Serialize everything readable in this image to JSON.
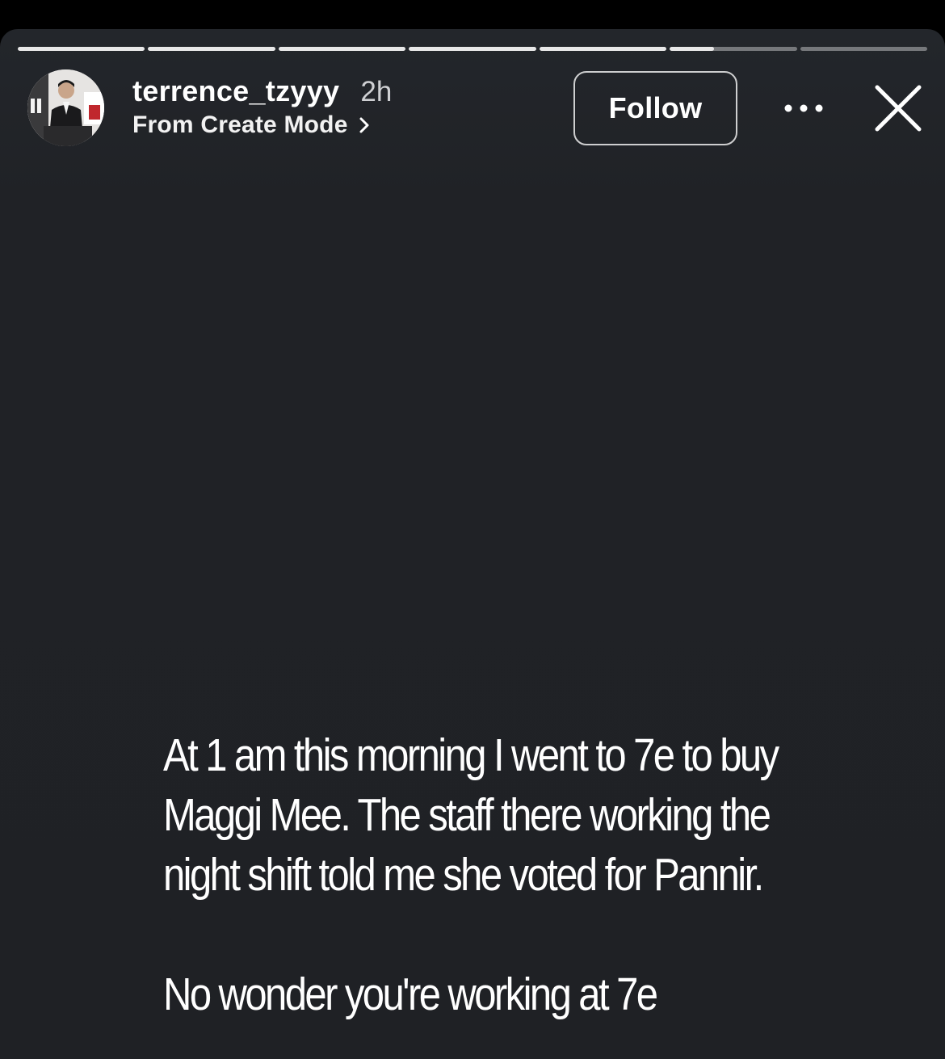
{
  "header": {
    "username": "terrence_tzyyy",
    "time_ago": "2h",
    "subtitle": "From Create Mode",
    "follow_label": "Follow"
  },
  "progress": {
    "segments": [
      1,
      1,
      1,
      1,
      1,
      0.35,
      0
    ]
  },
  "story": {
    "paragraph_1": "At 1 am this morning I went to 7e to buy\nMaggi Mee. The staff there working the\nnight shift told me she voted for Pannir.",
    "paragraph_2": "No wonder you're working at 7e"
  },
  "icons": {
    "avatar": "profile-photo",
    "chevron": "chevron-right-icon",
    "more": "more-horizontal-icon",
    "close": "close-icon"
  },
  "colors": {
    "background": "#1f2125",
    "progress_filled": "#e8e8e8",
    "progress_empty": "#7a7b7e",
    "text": "#ffffff"
  }
}
